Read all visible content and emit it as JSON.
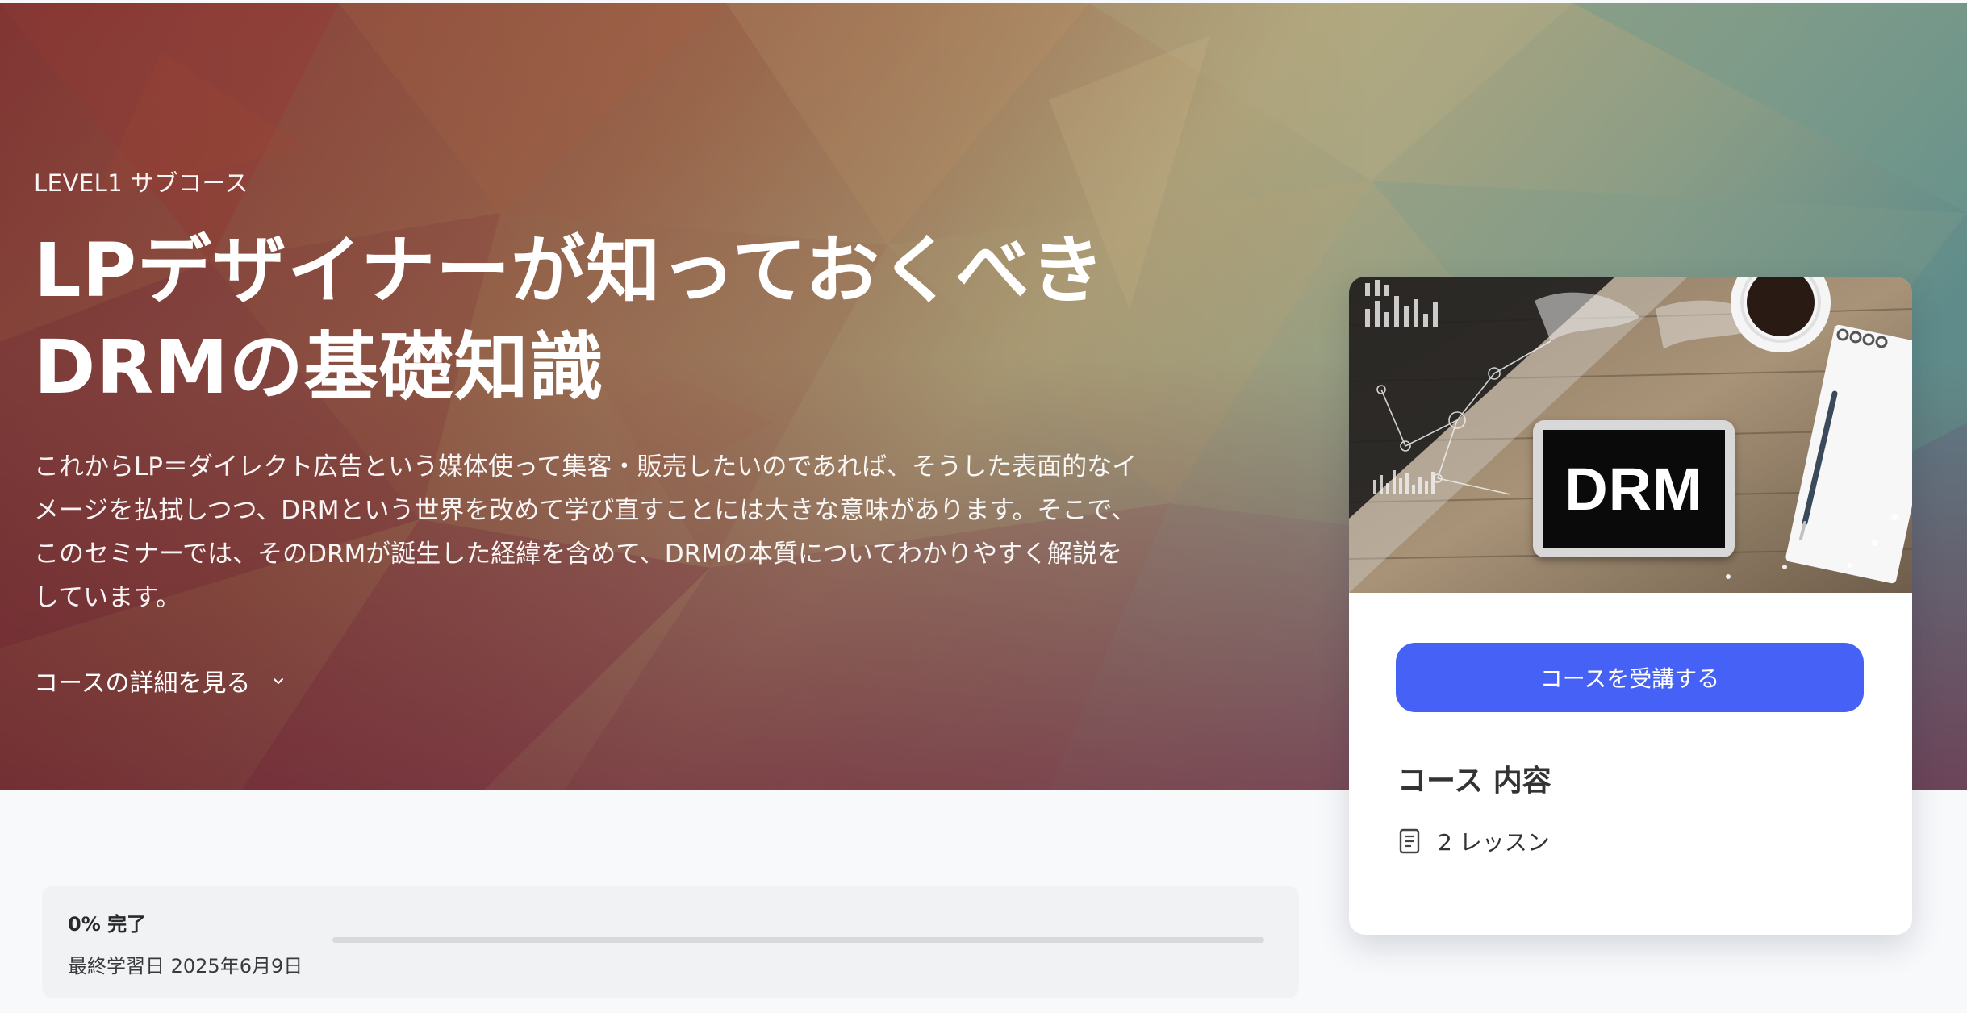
{
  "hero": {
    "course_tag": "LEVEL1 サブコース",
    "title_line1": "LPデザイナーが知っておくべき",
    "title_line2": "DRMの基礎知識",
    "description": "これからLP＝ダイレクト広告という媒体使って集客・販売したいのであれば、そうした表面的なイメージを払拭しつつ、DRMという世界を改めて学び直すことには大きな意味があります。そこで、このセミナーでは、そのDRMが誕生した経緯を含めて、DRMの本質についてわかりやすく解説をしています。",
    "details_link": "コースの詳細を見る",
    "details_icon": "chevron-down-icon"
  },
  "progress": {
    "percent_label": "0% 完了",
    "last_study": "最終学習日 2025年6月9日",
    "fraction": 0
  },
  "side_card": {
    "thumbnail_text": "DRM",
    "enroll_button": "コースを受講する",
    "content_heading": "コース 内容",
    "lessons_label": "2 レッスン",
    "lessons_icon": "book-icon"
  },
  "colors": {
    "accent": "#4561f6",
    "page_background": "#f8f9fb",
    "card_background": "#ffffff"
  }
}
